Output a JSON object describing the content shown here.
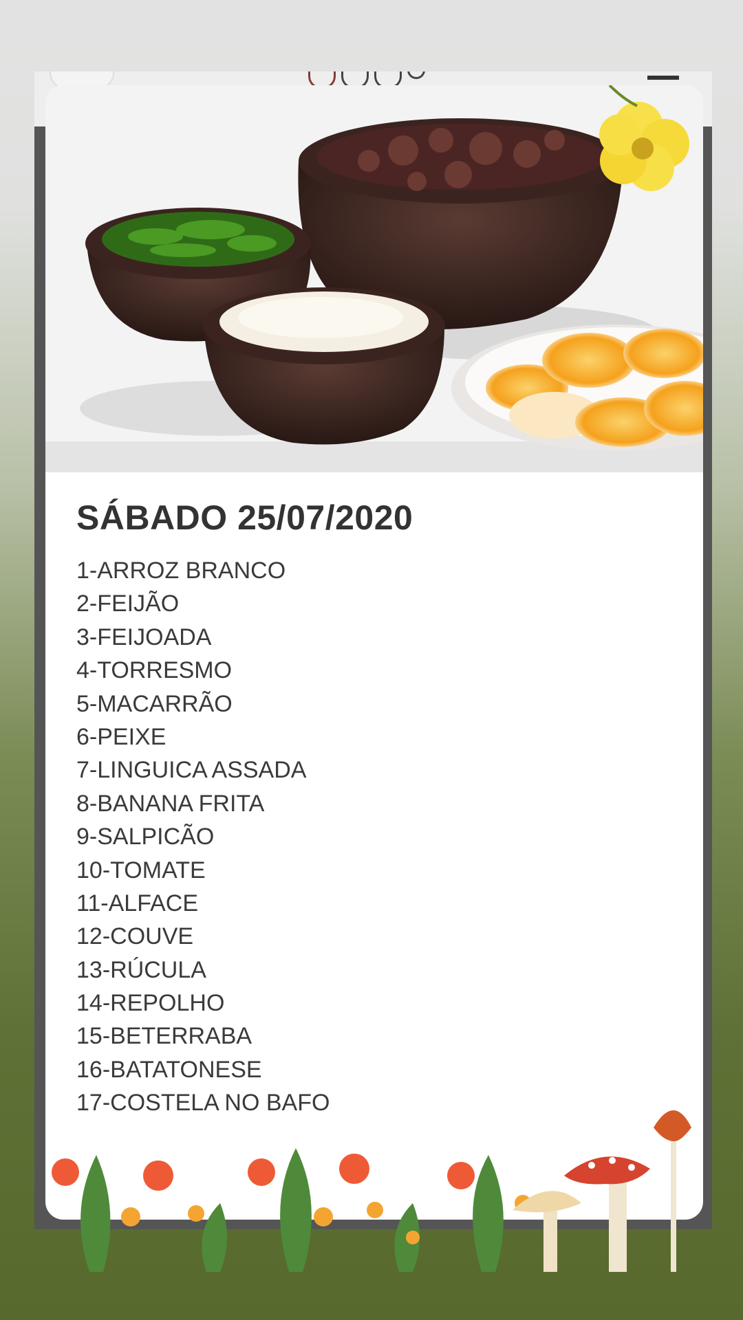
{
  "post": {
    "title": "SÁBADO 25/07/2020",
    "menu_items": [
      "1-ARROZ BRANCO",
      "2-FEIJÃO",
      "3-FEIJOADA",
      "4-TORRESMO",
      "5-MACARRÃO",
      "6-PEIXE",
      "7-LINGUICA ASSADA",
      "8-BANANA FRITA",
      "9-SALPICÃO",
      "10-TOMATE",
      "11-ALFACE",
      "12-COUVE",
      "13-RÚCULA",
      "14-REPOLHO",
      "15-BETERRABA",
      "16-BATATONESE",
      "17-COSTELA NO BAFO"
    ]
  },
  "colors": {
    "background_top": "#e2e2e2",
    "background_bottom": "#58692d",
    "text": "#333333"
  },
  "icons": [
    "restaurant-logo-icon",
    "clock-icon",
    "phone-icon",
    "location-icon",
    "chevron-down-icon",
    "menu-icon",
    "flower-icon",
    "mushroom-icon"
  ]
}
